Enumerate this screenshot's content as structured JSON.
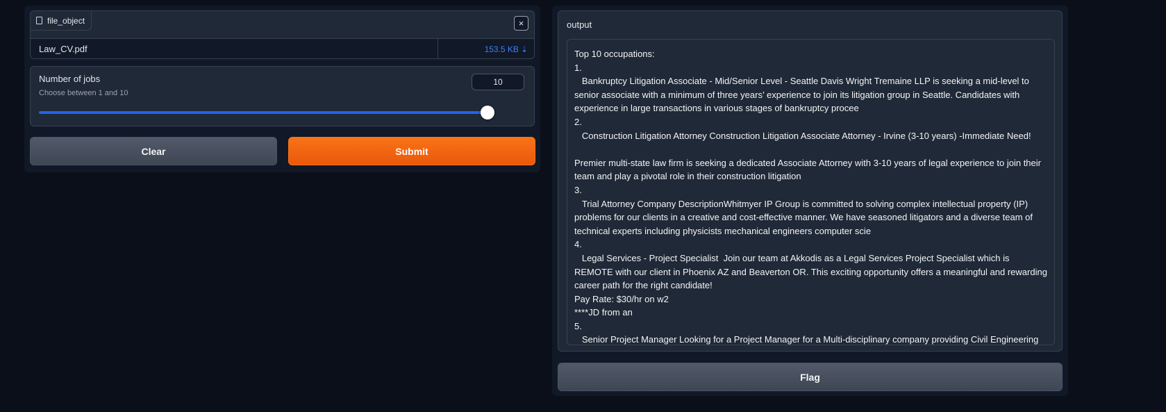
{
  "file_upload": {
    "label": "file_object",
    "close_symbol": "×",
    "file_name": "Law_CV.pdf",
    "file_size": "153.5 KB",
    "download_symbol": "⇣"
  },
  "slider": {
    "title": "Number of jobs",
    "info": "Choose between 1 and 10",
    "value": "10",
    "fraction": 1.0
  },
  "buttons": {
    "clear": "Clear",
    "submit": "Submit",
    "flag": "Flag"
  },
  "output": {
    "label": "output",
    "text": "Top 10 occupations:\n1.\n   Bankruptcy Litigation Associate - Mid/Senior Level - Seattle Davis Wright Tremaine LLP is seeking a mid-level to senior associate with a minimum of three years’ experience to join its litigation group in Seattle. Candidates with experience in large transactions in various stages of bankruptcy procee\n2.\n   Construction Litigation Attorney Construction Litigation Associate Attorney - Irvine (3-10 years) -Immediate Need!\n\nPremier multi-state law firm is seeking a dedicated Associate Attorney with 3-10 years of legal experience to join their team and play a pivotal role in their construction litigation\n3.\n   Trial Attorney Company DescriptionWhitmyer IP Group is committed to solving complex intellectual property (IP) problems for our clients in a creative and cost-effective manner. We have seasoned litigators and a diverse team of technical experts including physicists mechanical engineers computer scie\n4.\n   Legal Services - Project Specialist  Join our team at Akkodis as a Legal Services Project Specialist which is REMOTE with our client in Phoenix AZ and Beaverton OR. This exciting opportunity offers a meaningful and rewarding career path for the right candidate!\nPay Rate: $30/hr on w2\n****JD from an\n5.\n   Senior Project Manager Looking for a Project Manager for a Multi-disciplinary company providing Civil Engineering"
  },
  "colors": {
    "accent": "#f97316",
    "slider": "#2563eb",
    "link": "#3b82f6",
    "background": "#0b0f19"
  }
}
